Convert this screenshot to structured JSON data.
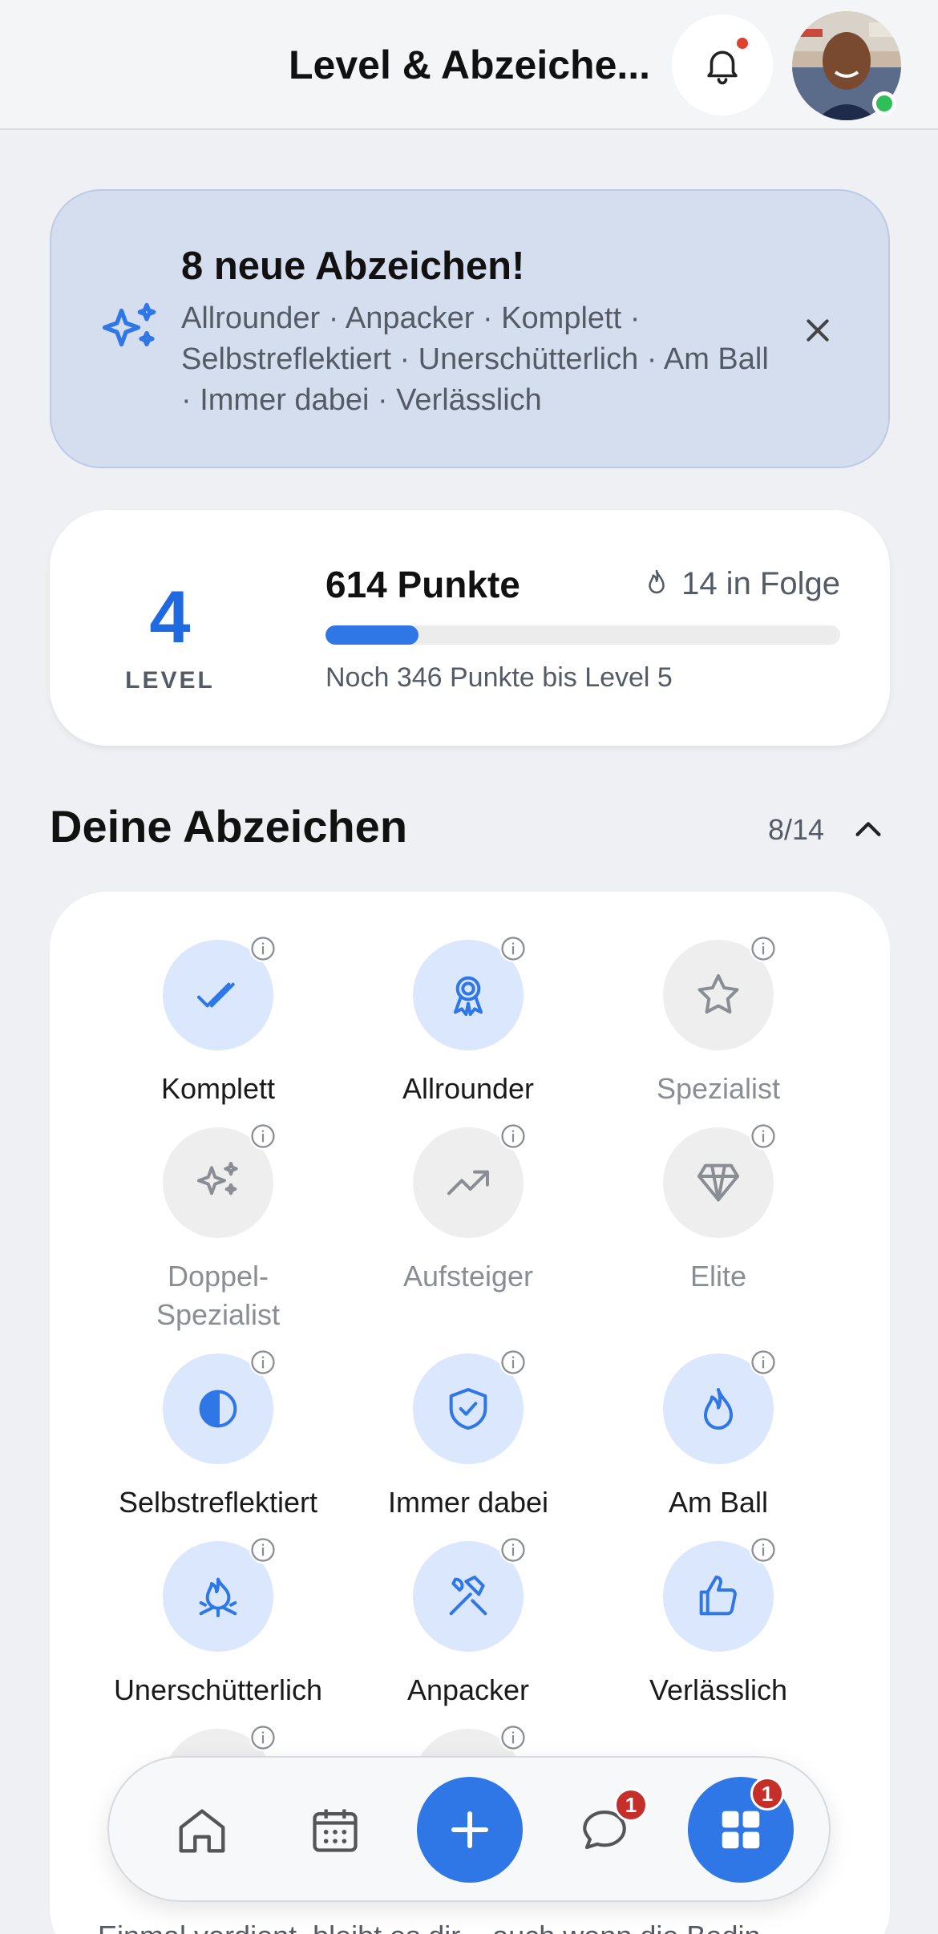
{
  "header": {
    "title": "Level & Abzeiche...",
    "notification_dot": true,
    "avatar_status": "online"
  },
  "banner": {
    "title": "8 neue Abzeichen!",
    "text": "Allrounder · Anpacker · Komplett · Selbstreflektiert · Unerschütterlich · Am Ball · Immer dabei · Verlässlich",
    "icon": "sparkles-icon",
    "close_icon": "close-icon"
  },
  "level": {
    "number": "4",
    "label": "LEVEL",
    "points": "614 Punkte",
    "streak": "14 in Folge",
    "progress_fraction": 0.18,
    "caption": "Noch 346 Punkte bis Level 5"
  },
  "badges_section": {
    "title": "Deine Abzeichen",
    "count": "8/14",
    "items": [
      {
        "label": "Komplett",
        "earned": true,
        "icon": "double-check-icon"
      },
      {
        "label": "Allrounder",
        "earned": true,
        "icon": "award-ribbon-icon"
      },
      {
        "label": "Spezialist",
        "earned": false,
        "icon": "star-icon"
      },
      {
        "label": "Doppel-\nSpezialist",
        "earned": false,
        "icon": "sparkles-icon"
      },
      {
        "label": "Aufsteiger",
        "earned": false,
        "icon": "trending-up-icon"
      },
      {
        "label": "Elite",
        "earned": false,
        "icon": "diamond-icon"
      },
      {
        "label": "Selbstreflektiert",
        "earned": true,
        "icon": "half-circle-icon"
      },
      {
        "label": "Immer dabei",
        "earned": true,
        "icon": "shield-check-icon"
      },
      {
        "label": "Am Ball",
        "earned": true,
        "icon": "flame-icon"
      },
      {
        "label": "Unerschütterlich",
        "earned": true,
        "icon": "campfire-icon"
      },
      {
        "label": "Anpacker",
        "earned": true,
        "icon": "hammer-wrench-icon"
      },
      {
        "label": "Verlässlich",
        "earned": true,
        "icon": "thumbs-up-icon"
      }
    ],
    "footer_text": "Einmal verdient, bleibt es dir – auch wenn die Bedin"
  },
  "nav": {
    "chat_badge": "1",
    "grid_badge": "1"
  },
  "colors": {
    "accent": "#2f77e6",
    "banner_bg": "#d5deef",
    "badge_on_bg": "#dbe7fd",
    "badge_off_bg": "#eeeeee",
    "notification_red": "#c62e2a"
  }
}
